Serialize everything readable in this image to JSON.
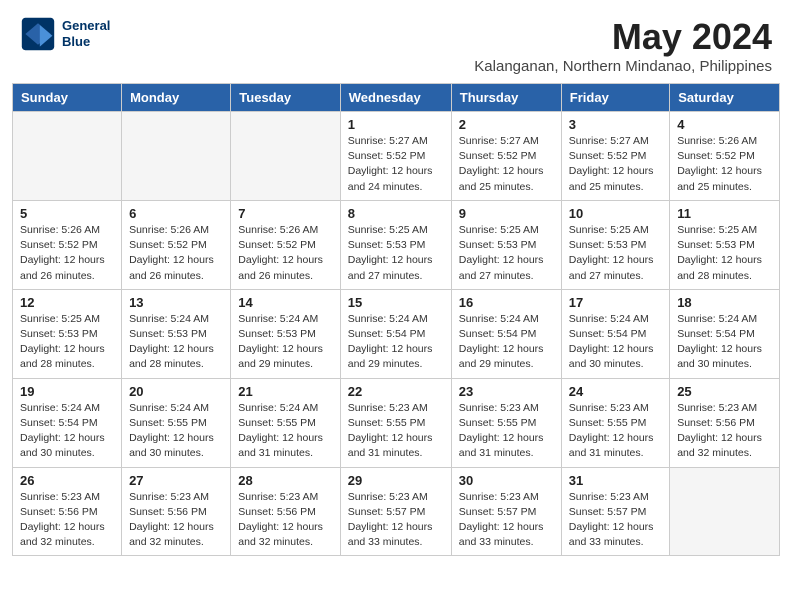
{
  "header": {
    "logo_line1": "General",
    "logo_line2": "Blue",
    "month_year": "May 2024",
    "location": "Kalanganan, Northern Mindanao, Philippines"
  },
  "days_of_week": [
    "Sunday",
    "Monday",
    "Tuesday",
    "Wednesday",
    "Thursday",
    "Friday",
    "Saturday"
  ],
  "weeks": [
    [
      {
        "day": "",
        "info": ""
      },
      {
        "day": "",
        "info": ""
      },
      {
        "day": "",
        "info": ""
      },
      {
        "day": "1",
        "info": "Sunrise: 5:27 AM\nSunset: 5:52 PM\nDaylight: 12 hours\nand 24 minutes."
      },
      {
        "day": "2",
        "info": "Sunrise: 5:27 AM\nSunset: 5:52 PM\nDaylight: 12 hours\nand 25 minutes."
      },
      {
        "day": "3",
        "info": "Sunrise: 5:27 AM\nSunset: 5:52 PM\nDaylight: 12 hours\nand 25 minutes."
      },
      {
        "day": "4",
        "info": "Sunrise: 5:26 AM\nSunset: 5:52 PM\nDaylight: 12 hours\nand 25 minutes."
      }
    ],
    [
      {
        "day": "5",
        "info": "Sunrise: 5:26 AM\nSunset: 5:52 PM\nDaylight: 12 hours\nand 26 minutes."
      },
      {
        "day": "6",
        "info": "Sunrise: 5:26 AM\nSunset: 5:52 PM\nDaylight: 12 hours\nand 26 minutes."
      },
      {
        "day": "7",
        "info": "Sunrise: 5:26 AM\nSunset: 5:52 PM\nDaylight: 12 hours\nand 26 minutes."
      },
      {
        "day": "8",
        "info": "Sunrise: 5:25 AM\nSunset: 5:53 PM\nDaylight: 12 hours\nand 27 minutes."
      },
      {
        "day": "9",
        "info": "Sunrise: 5:25 AM\nSunset: 5:53 PM\nDaylight: 12 hours\nand 27 minutes."
      },
      {
        "day": "10",
        "info": "Sunrise: 5:25 AM\nSunset: 5:53 PM\nDaylight: 12 hours\nand 27 minutes."
      },
      {
        "day": "11",
        "info": "Sunrise: 5:25 AM\nSunset: 5:53 PM\nDaylight: 12 hours\nand 28 minutes."
      }
    ],
    [
      {
        "day": "12",
        "info": "Sunrise: 5:25 AM\nSunset: 5:53 PM\nDaylight: 12 hours\nand 28 minutes."
      },
      {
        "day": "13",
        "info": "Sunrise: 5:24 AM\nSunset: 5:53 PM\nDaylight: 12 hours\nand 28 minutes."
      },
      {
        "day": "14",
        "info": "Sunrise: 5:24 AM\nSunset: 5:53 PM\nDaylight: 12 hours\nand 29 minutes."
      },
      {
        "day": "15",
        "info": "Sunrise: 5:24 AM\nSunset: 5:54 PM\nDaylight: 12 hours\nand 29 minutes."
      },
      {
        "day": "16",
        "info": "Sunrise: 5:24 AM\nSunset: 5:54 PM\nDaylight: 12 hours\nand 29 minutes."
      },
      {
        "day": "17",
        "info": "Sunrise: 5:24 AM\nSunset: 5:54 PM\nDaylight: 12 hours\nand 30 minutes."
      },
      {
        "day": "18",
        "info": "Sunrise: 5:24 AM\nSunset: 5:54 PM\nDaylight: 12 hours\nand 30 minutes."
      }
    ],
    [
      {
        "day": "19",
        "info": "Sunrise: 5:24 AM\nSunset: 5:54 PM\nDaylight: 12 hours\nand 30 minutes."
      },
      {
        "day": "20",
        "info": "Sunrise: 5:24 AM\nSunset: 5:55 PM\nDaylight: 12 hours\nand 30 minutes."
      },
      {
        "day": "21",
        "info": "Sunrise: 5:24 AM\nSunset: 5:55 PM\nDaylight: 12 hours\nand 31 minutes."
      },
      {
        "day": "22",
        "info": "Sunrise: 5:23 AM\nSunset: 5:55 PM\nDaylight: 12 hours\nand 31 minutes."
      },
      {
        "day": "23",
        "info": "Sunrise: 5:23 AM\nSunset: 5:55 PM\nDaylight: 12 hours\nand 31 minutes."
      },
      {
        "day": "24",
        "info": "Sunrise: 5:23 AM\nSunset: 5:55 PM\nDaylight: 12 hours\nand 31 minutes."
      },
      {
        "day": "25",
        "info": "Sunrise: 5:23 AM\nSunset: 5:56 PM\nDaylight: 12 hours\nand 32 minutes."
      }
    ],
    [
      {
        "day": "26",
        "info": "Sunrise: 5:23 AM\nSunset: 5:56 PM\nDaylight: 12 hours\nand 32 minutes."
      },
      {
        "day": "27",
        "info": "Sunrise: 5:23 AM\nSunset: 5:56 PM\nDaylight: 12 hours\nand 32 minutes."
      },
      {
        "day": "28",
        "info": "Sunrise: 5:23 AM\nSunset: 5:56 PM\nDaylight: 12 hours\nand 32 minutes."
      },
      {
        "day": "29",
        "info": "Sunrise: 5:23 AM\nSunset: 5:57 PM\nDaylight: 12 hours\nand 33 minutes."
      },
      {
        "day": "30",
        "info": "Sunrise: 5:23 AM\nSunset: 5:57 PM\nDaylight: 12 hours\nand 33 minutes."
      },
      {
        "day": "31",
        "info": "Sunrise: 5:23 AM\nSunset: 5:57 PM\nDaylight: 12 hours\nand 33 minutes."
      },
      {
        "day": "",
        "info": ""
      }
    ]
  ]
}
